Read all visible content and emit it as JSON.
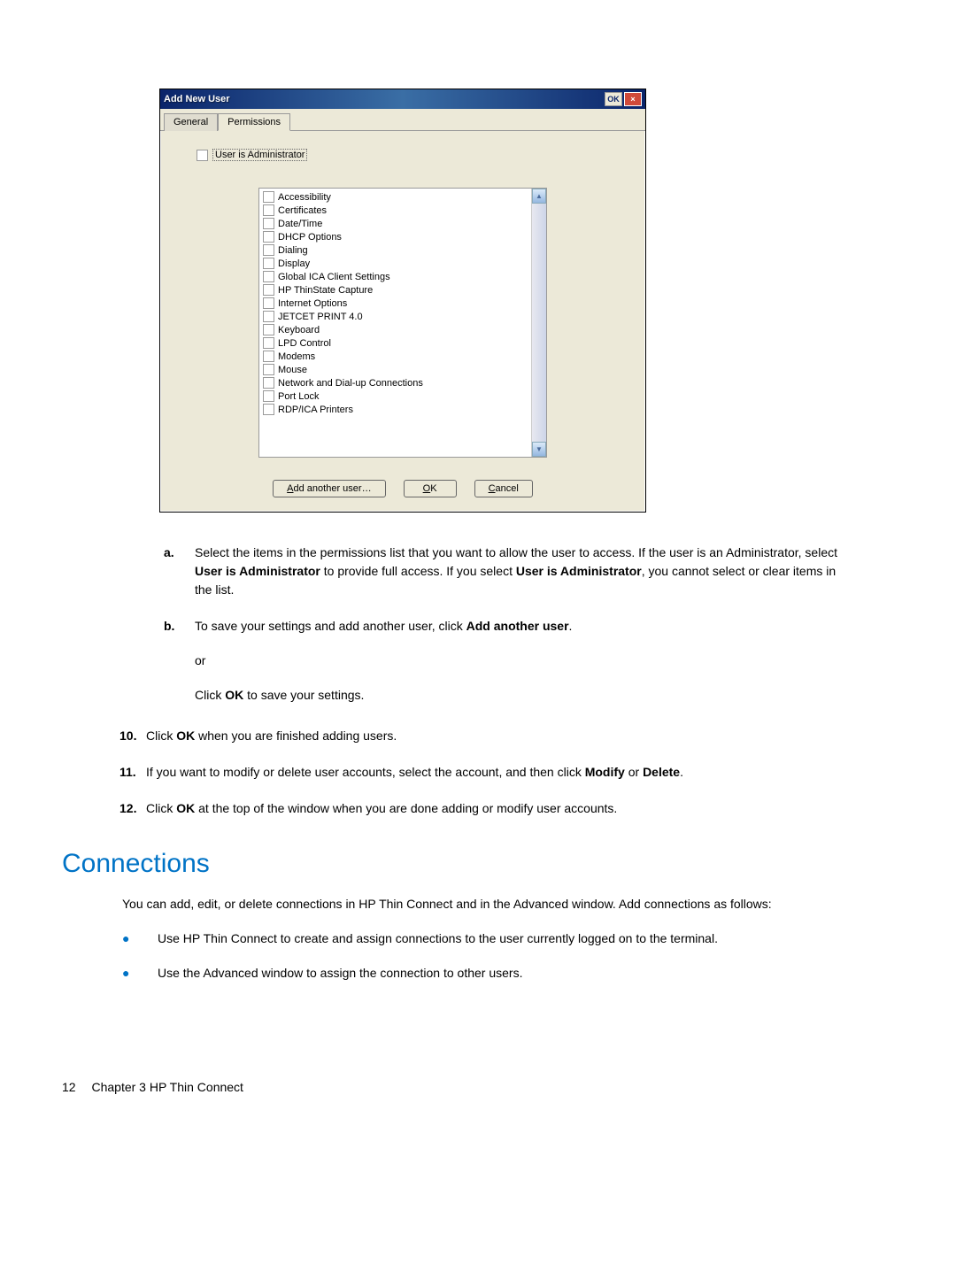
{
  "dialog": {
    "title": "Add New User",
    "ok_btn": "OK",
    "close_btn": "×",
    "tabs": {
      "general": "General",
      "permissions": "Permissions"
    },
    "admin_label": "User is Administrator",
    "permissions": [
      "Accessibility",
      "Certificates",
      "Date/Time",
      "DHCP Options",
      "Dialing",
      "Display",
      "Global ICA Client Settings",
      "HP ThinState Capture",
      "Internet Options",
      "JETCET PRINT 4.0",
      "Keyboard",
      "LPD Control",
      "Modems",
      "Mouse",
      "Network and Dial-up Connections",
      "Port Lock",
      "RDP/ICA Printers"
    ],
    "buttons": {
      "add_another_prefix": "A",
      "add_another_rest": "dd another user…",
      "ok_prefix": "O",
      "ok_rest": "K",
      "cancel_prefix": "C",
      "cancel_rest": "ancel"
    }
  },
  "steps": {
    "a_marker": "a.",
    "a_text_1": "Select the items in the permissions list that you want to allow the user to access. If the user is an Administrator, select ",
    "a_bold_1": "User is Administrator",
    "a_text_2": " to provide full access. If you select ",
    "a_bold_2": "User is Administrator",
    "a_text_3": ", you cannot select or clear items in the list.",
    "b_marker": "b.",
    "b_text_1": "To save your settings and add another user, click ",
    "b_bold_1": "Add another user",
    "b_text_2": ".",
    "b_or": "or",
    "b_text_3a": "Click ",
    "b_bold_3": "OK",
    "b_text_3b": " to save your settings.",
    "n10_marker": "10.",
    "n10_a": "Click ",
    "n10_bold": "OK",
    "n10_b": " when you are finished adding users.",
    "n11_marker": "11.",
    "n11_a": "If you want to modify or delete user accounts, select the account, and then click ",
    "n11_bold1": "Modify",
    "n11_mid": " or ",
    "n11_bold2": "Delete",
    "n11_end": ".",
    "n12_marker": "12.",
    "n12_a": "Click ",
    "n12_bold": "OK",
    "n12_b": " at the top of the window when you are done adding or modify user accounts."
  },
  "section": {
    "heading": "Connections",
    "intro": "You can add, edit, or delete connections in HP Thin Connect and in the Advanced window. Add connections as follows:",
    "bullet1": "Use HP Thin Connect to create and assign connections to the user currently logged on to the terminal.",
    "bullet2": "Use the Advanced window to assign the connection to other users."
  },
  "footer": {
    "page": "12",
    "chapter": "Chapter 3   HP Thin Connect"
  }
}
